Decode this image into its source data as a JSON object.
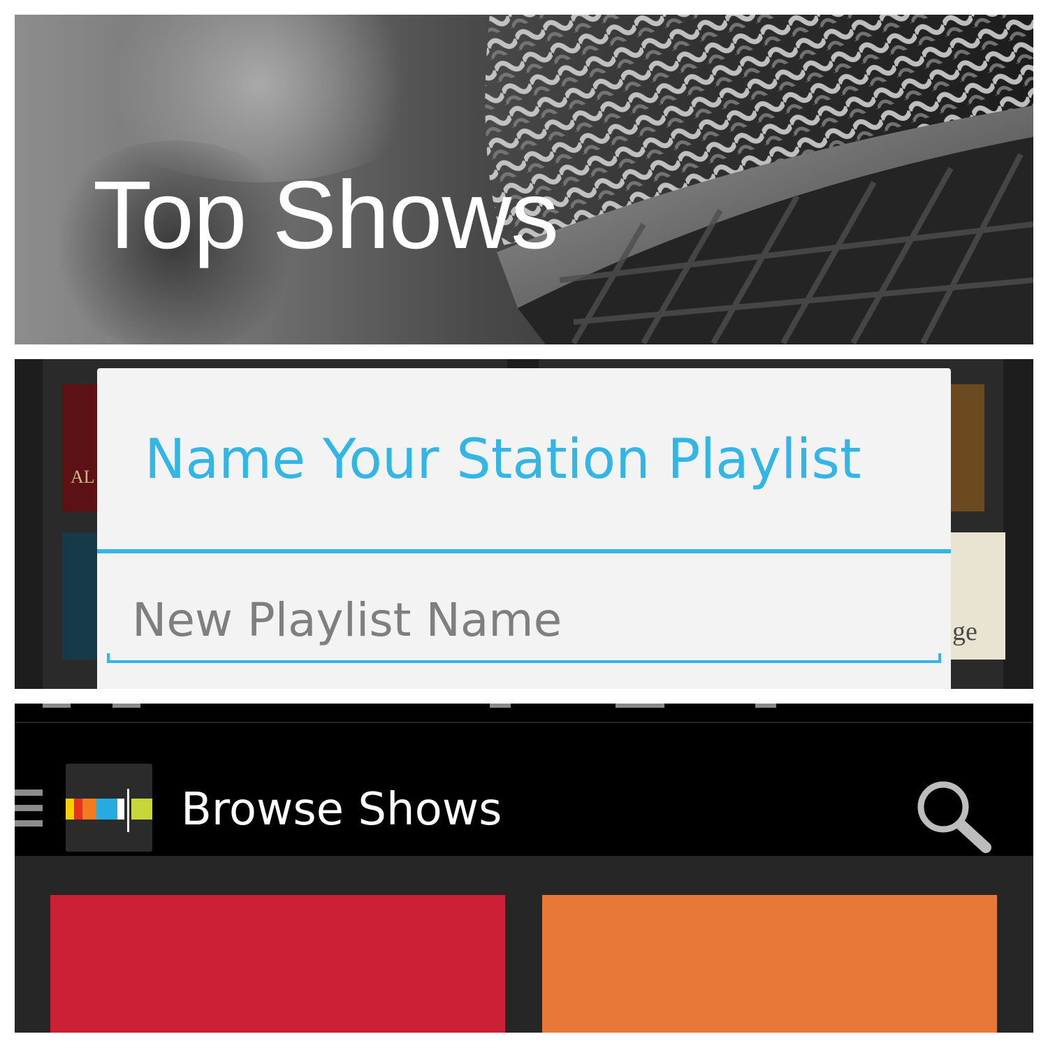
{
  "banner": {
    "title": "Top Shows"
  },
  "dialog": {
    "title": "Name Your Station Playlist",
    "input_placeholder": "New Playlist Name",
    "input_value": "",
    "accent_color": "#33b5e5"
  },
  "appbar": {
    "title": "Browse Shows",
    "icons": [
      "menu-icon",
      "app-logo-icon",
      "search-icon"
    ]
  },
  "categories": [
    {
      "color": "#cc2037"
    },
    {
      "color": "#e87838"
    }
  ],
  "colors": {
    "appbar_bg": "#000000",
    "content_bg": "#262626",
    "dialog_bg": "#f3f3f3"
  }
}
